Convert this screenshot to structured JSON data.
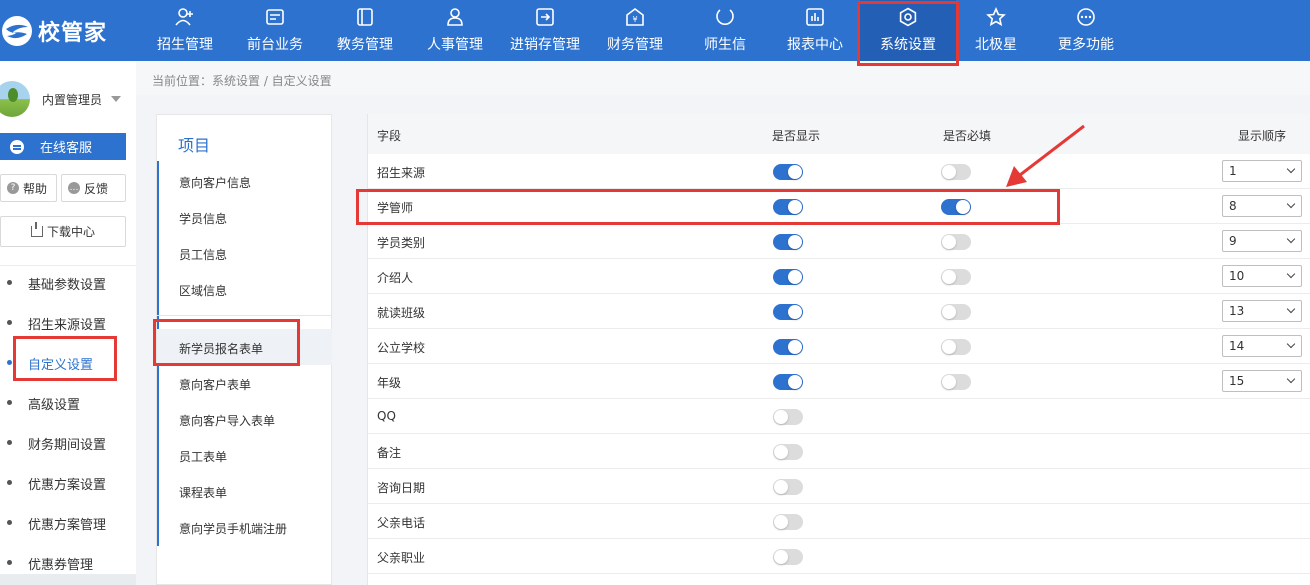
{
  "app": {
    "logo_text": "校管家"
  },
  "nav": [
    {
      "label": "招生管理",
      "icon": "user-plus-icon"
    },
    {
      "label": "前台业务",
      "icon": "card-icon"
    },
    {
      "label": "教务管理",
      "icon": "book-icon"
    },
    {
      "label": "人事管理",
      "icon": "person-icon"
    },
    {
      "label": "进销存管理",
      "icon": "inventory-icon"
    },
    {
      "label": "财务管理",
      "icon": "yen-icon"
    },
    {
      "label": "师生信",
      "icon": "chat-icon"
    },
    {
      "label": "报表中心",
      "icon": "report-icon"
    },
    {
      "label": "系统设置",
      "icon": "gear-icon",
      "active": true
    },
    {
      "label": "北极星",
      "icon": "star-icon"
    },
    {
      "label": "更多功能",
      "icon": "more-icon"
    }
  ],
  "user": {
    "name": "内置管理员"
  },
  "sidebar": {
    "online_service": "在线客服",
    "help": "帮助",
    "feedback": "反馈",
    "download": "下载中心",
    "menu": [
      {
        "label": "基础参数设置"
      },
      {
        "label": "招生来源设置"
      },
      {
        "label": "自定义设置",
        "active": true
      },
      {
        "label": "高级设置"
      },
      {
        "label": "财务期间设置"
      },
      {
        "label": "优惠方案设置"
      },
      {
        "label": "优惠方案管理"
      },
      {
        "label": "优惠券管理"
      }
    ]
  },
  "breadcrumb": "当前位置：系统设置 / 自定义设置",
  "projects": {
    "title": "项目",
    "items": [
      {
        "label": "意向客户信息"
      },
      {
        "label": "学员信息"
      },
      {
        "label": "员工信息"
      },
      {
        "label": "区域信息"
      },
      {
        "label": "新学员报名表单",
        "active": true
      },
      {
        "label": "意向客户表单"
      },
      {
        "label": "意向客户导入表单"
      },
      {
        "label": "员工表单"
      },
      {
        "label": "课程表单"
      },
      {
        "label": "意向学员手机端注册"
      }
    ]
  },
  "table": {
    "headers": {
      "field": "字段",
      "show": "是否显示",
      "required": "是否必填",
      "order": "显示顺序"
    },
    "rows": [
      {
        "field": "招生来源",
        "show": true,
        "required": false,
        "order": "1"
      },
      {
        "field": "学管师",
        "show": true,
        "required": true,
        "order": "8"
      },
      {
        "field": "学员类别",
        "show": true,
        "required": false,
        "order": "9"
      },
      {
        "field": "介绍人",
        "show": true,
        "required": false,
        "order": "10"
      },
      {
        "field": "就读班级",
        "show": true,
        "required": false,
        "order": "13"
      },
      {
        "field": "公立学校",
        "show": true,
        "required": false,
        "order": "14"
      },
      {
        "field": "年级",
        "show": true,
        "required": false,
        "order": "15"
      },
      {
        "field": "QQ",
        "show": false,
        "required": null,
        "order": null
      },
      {
        "field": "备注",
        "show": false,
        "required": null,
        "order": null
      },
      {
        "field": "咨询日期",
        "show": false,
        "required": null,
        "order": null
      },
      {
        "field": "父亲电话",
        "show": false,
        "required": null,
        "order": null
      },
      {
        "field": "父亲职业",
        "show": false,
        "required": null,
        "order": null
      }
    ]
  },
  "colors": {
    "primary": "#2d72cf",
    "highlight": "#e53935",
    "toggle_off": "#dcdcdc"
  }
}
